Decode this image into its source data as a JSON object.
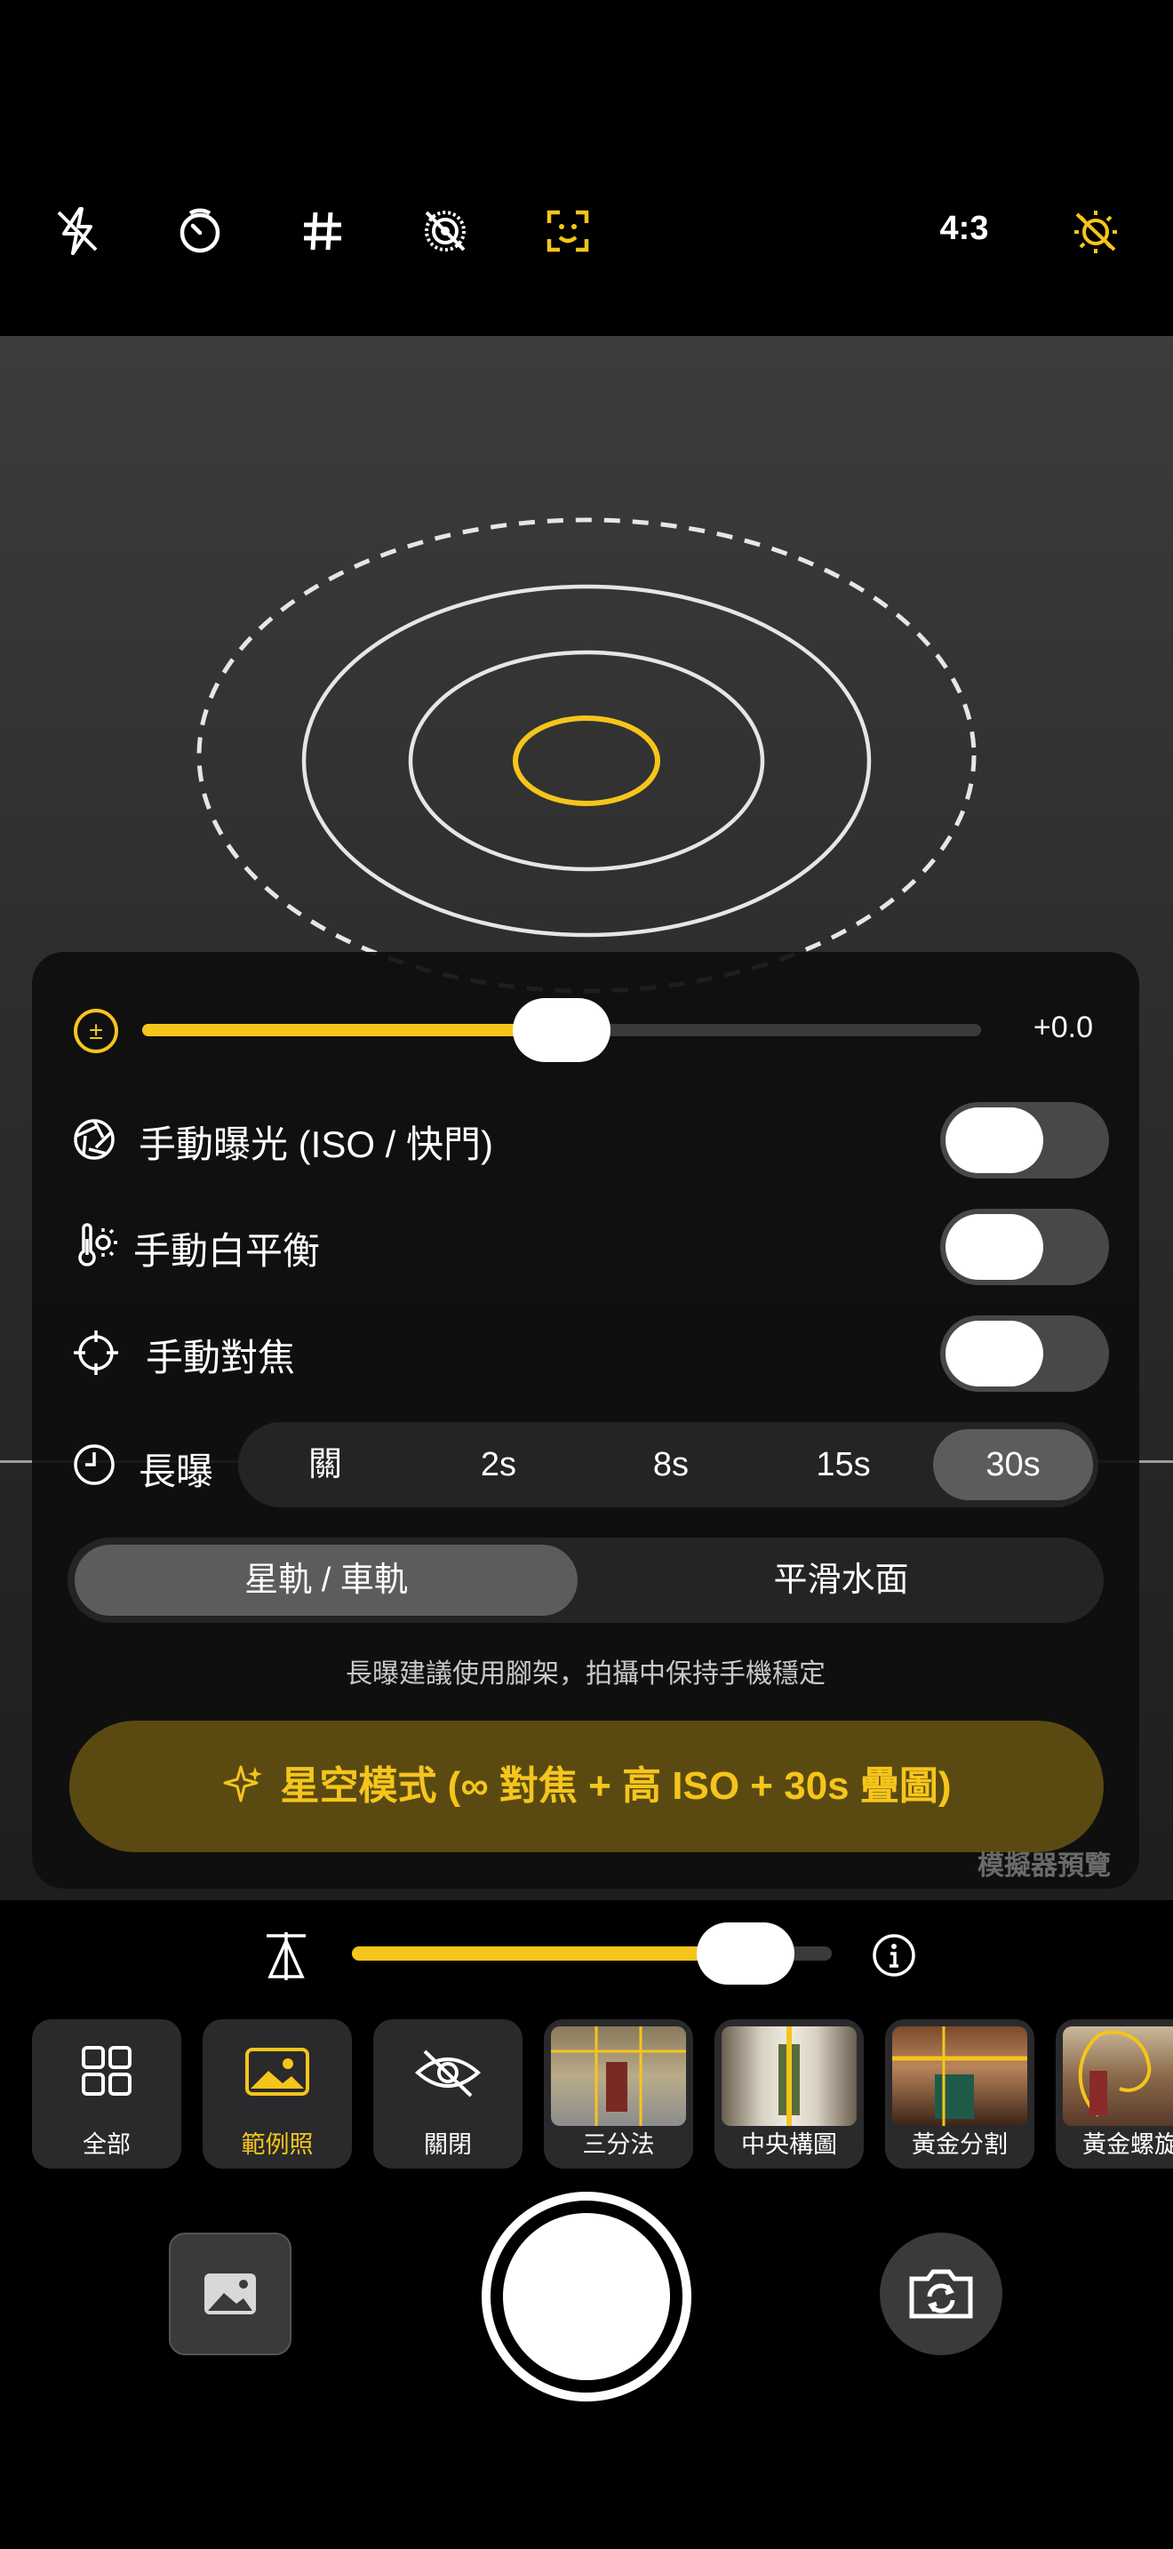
{
  "top_bar": {
    "icons": [
      "flash-off-icon",
      "timer-icon",
      "grid-icon",
      "live-photo-off-icon",
      "face-detect-icon",
      "sun-settings-icon"
    ],
    "aspect_ratio": "4:3",
    "accent": "#f5c51b"
  },
  "exposure": {
    "value_label": "+0.0",
    "slider_level": 0.5
  },
  "toggles": [
    {
      "label": "手動曝光 (ISO / 快門)",
      "icon": "aperture-icon",
      "on": false
    },
    {
      "label": "手動白平衡",
      "icon": "thermometer-sun-icon",
      "on": false
    },
    {
      "label": "手動對焦",
      "icon": "focus-crosshair-icon",
      "on": false
    }
  ],
  "long_exposure": {
    "label": "長曝",
    "icon": "clock-icon",
    "options": [
      "關",
      "2s",
      "8s",
      "15s",
      "30s"
    ],
    "selected": "30s"
  },
  "long_exposure_mode": {
    "options": [
      "星軌 / 車軌",
      "平滑水面"
    ],
    "selected": "星軌 / 車軌"
  },
  "hint": "長曝建議使用腳架，拍攝中保持手機穩定",
  "starry_button": {
    "icon": "sparkle-icon",
    "label": "星空模式 (∞ 對焦 + 高 ISO + 30s 疊圖)"
  },
  "watermark": "模擬器預覽",
  "zoom": {
    "level": 0.82,
    "left_icon": "level-triangle-icon",
    "right_icon": "info-icon"
  },
  "composition_tiles": [
    {
      "label": "全部",
      "icon": "grid-four-icon",
      "active": false
    },
    {
      "label": "範例照",
      "icon": "image-icon",
      "active": true
    },
    {
      "label": "關閉",
      "icon": "eye-off-icon",
      "active": false
    },
    {
      "label": "三分法",
      "thumb": true
    },
    {
      "label": "中央構圖",
      "thumb": true
    },
    {
      "label": "黃金分割",
      "thumb": true
    },
    {
      "label": "黃金螺旋",
      "thumb": true
    }
  ],
  "bottom_controls": {
    "gallery_icon": "photo-library-icon",
    "shutter": "shutter-button",
    "flip_icon": "camera-flip-icon"
  }
}
